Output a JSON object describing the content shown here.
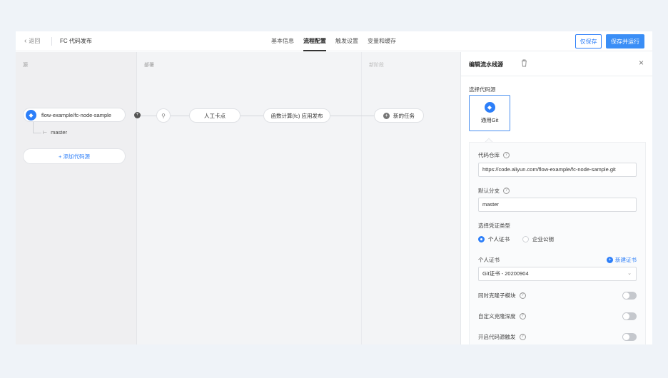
{
  "topbar": {
    "back_label": "返回",
    "app_title": "FC 代码发布",
    "tabs": [
      "基本信息",
      "流程配置",
      "触发设置",
      "变量和缓存"
    ],
    "active_tab": "流程配置",
    "save_only_label": "仅保存",
    "save_run_label": "保存并运行"
  },
  "pipeline": {
    "stages": [
      "源",
      "部署",
      "新阶段"
    ],
    "source": {
      "repo": "flow-example/fc-node-sample",
      "branch": "master",
      "add_label": "+ 添加代码源"
    },
    "tasks": [
      "人工卡点",
      "函数计算(fc) 应用发布"
    ],
    "new_task_label": "新的任务"
  },
  "panel": {
    "title": "编辑流水线源",
    "select_source_label": "选择代码源",
    "source_option": "通用Git",
    "repo_label": "代码仓库",
    "repo_value": "https://code.aliyun.com/flow-example/fc-node-sample.git",
    "branch_label": "默认分支",
    "branch_value": "master",
    "cert_type_label": "选择凭证类型",
    "cert_types": [
      "个人证书",
      "企业公钥"
    ],
    "personal_cert_label": "个人证书",
    "new_cert_label": "新建证书",
    "cert_value": "Git证书 - 20200904",
    "toggles": [
      "同时克隆子模块",
      "自定义克隆深度",
      "开启代码源触发"
    ]
  },
  "colors": {
    "accent": "#2d7ff9",
    "canvas_bg": "#f3f4f6"
  }
}
